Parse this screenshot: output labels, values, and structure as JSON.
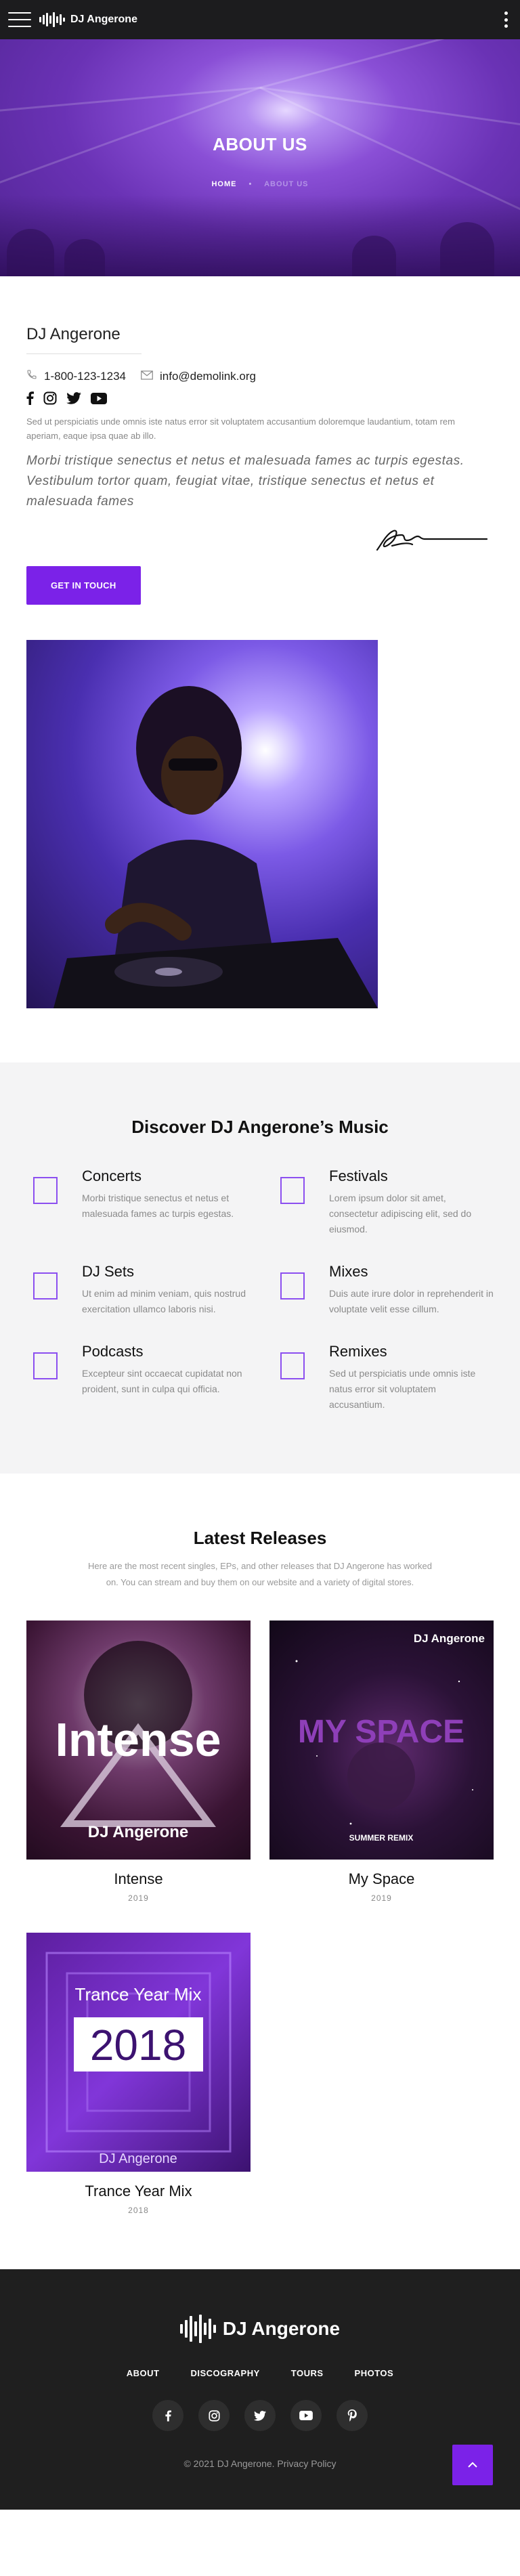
{
  "header": {
    "brand": "DJ Angerone",
    "menu_icon": "hamburger-menu-icon",
    "more_icon": "more-vertical-icon"
  },
  "hero": {
    "title": "ABOUT US",
    "breadcrumb_home": "HOME",
    "breadcrumb_current": "ABOUT US"
  },
  "about": {
    "name": "DJ Angerone",
    "phone": "1-800-123-1234",
    "email": "info@demolink.org",
    "intro": "Sed ut perspiciatis unde omnis iste natus error sit voluptatem accusantium doloremque laudantium, totam rem aperiam, eaque ipsa quae ab illo.",
    "quote": "Morbi tristique senectus et netus et malesuada fames ac turpis egestas. Vestibulum tortor quam, feugiat vitae, tristique senectus et netus et malesuada fames",
    "cta_label": "GET IN TOUCH",
    "social_icons": [
      "facebook-icon",
      "instagram-icon",
      "twitter-icon",
      "youtube-icon"
    ]
  },
  "discover": {
    "title": "Discover DJ Angerone’s Music",
    "items": [
      {
        "title": "Concerts",
        "text": "Morbi tristique senectus et netus et malesuada fames ac turpis egestas."
      },
      {
        "title": "Festivals",
        "text": "Lorem ipsum dolor sit amet, consectetur adipiscing elit, sed do eiusmod."
      },
      {
        "title": "DJ Sets",
        "text": "Ut enim ad minim veniam, quis nostrud exercitation ullamco laboris nisi."
      },
      {
        "title": "Mixes",
        "text": "Duis aute irure dolor in reprehenderit in voluptate velit esse cillum."
      },
      {
        "title": "Podcasts",
        "text": "Excepteur sint occaecat cupidatat non proident, sunt in culpa qui officia."
      },
      {
        "title": "Remixes",
        "text": "Sed ut perspiciatis unde omnis iste natus error sit voluptatem accusantium."
      }
    ]
  },
  "releases": {
    "title": "Latest Releases",
    "subtitle": "Here are the most recent singles, EPs, and other releases that DJ Angerone has worked on. You can stream and buy them on our website and a variety of digital stores.",
    "items": [
      {
        "title": "Intense",
        "year": "2019",
        "cover_word": "Intense",
        "cover_artist": "DJ Angerone"
      },
      {
        "title": "My Space",
        "year": "2019",
        "cover_word": "MY SPACE",
        "cover_artist": "DJ Angerone",
        "cover_tag": "SUMMER REMIX"
      },
      {
        "title": "Trance Year Mix",
        "year": "2018",
        "cover_word": "Trance Year Mix",
        "cover_number": "2018",
        "cover_artist": "DJ Angerone"
      }
    ]
  },
  "footer": {
    "brand": "DJ Angerone",
    "nav": [
      "ABOUT",
      "DISCOGRAPHY",
      "TOURS",
      "PHOTOS"
    ],
    "social_icons": [
      "facebook-icon",
      "instagram-icon",
      "twitter-icon",
      "youtube-icon",
      "pinterest-icon"
    ],
    "copyright": "© 2021 DJ Angerone. Privacy Policy",
    "back_to_top_icon": "chevron-up-icon"
  },
  "colors": {
    "accent": "#7b22e8",
    "dark": "#1c1c1e"
  }
}
